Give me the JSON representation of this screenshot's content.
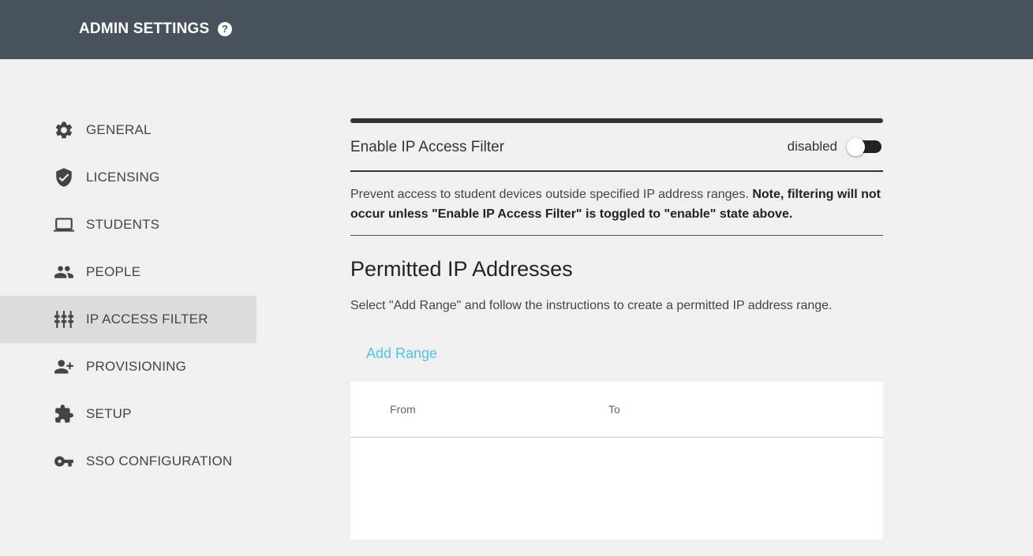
{
  "header": {
    "title": "ADMIN SETTINGS",
    "help_icon": "?"
  },
  "sidebar": {
    "items": [
      {
        "label": "GENERAL",
        "icon": "gear-icon"
      },
      {
        "label": "LICENSING",
        "icon": "shield-check-icon"
      },
      {
        "label": "STUDENTS",
        "icon": "laptop-icon"
      },
      {
        "label": "PEOPLE",
        "icon": "people-icon"
      },
      {
        "label": "IP ACCESS FILTER",
        "icon": "sliders-icon",
        "active": true
      },
      {
        "label": "PROVISIONING",
        "icon": "person-add-icon"
      },
      {
        "label": "SETUP",
        "icon": "puzzle-icon"
      },
      {
        "label": "SSO CONFIGURATION",
        "icon": "key-icon"
      }
    ]
  },
  "filter": {
    "title": "Enable IP Access Filter",
    "status": "disabled",
    "enabled": false,
    "description": "Prevent access to student devices outside specified IP address ranges. ",
    "description_note": "Note, filtering will not occur unless \"Enable IP Access Filter\" is toggled to \"enable\" state above."
  },
  "permitted": {
    "title": "Permitted IP Addresses",
    "description": "Select \"Add Range\" and follow the instructions to create a permitted IP address range.",
    "add_range_label": "Add Range",
    "columns": [
      "From",
      "To"
    ],
    "rows": []
  },
  "colors": {
    "header_bg": "#48525c",
    "accent": "#4fc4e0",
    "active_nav_bg": "#dcdcdc"
  }
}
